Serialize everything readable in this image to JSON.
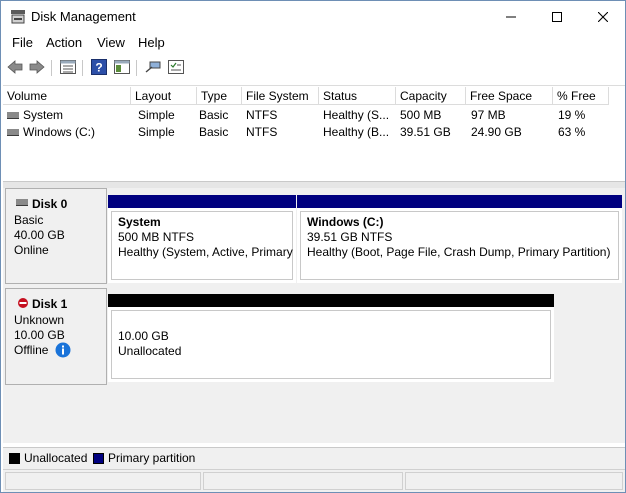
{
  "window": {
    "title": "Disk Management"
  },
  "menu": [
    "File",
    "Action",
    "View",
    "Help"
  ],
  "volume_list": {
    "columns": [
      "Volume",
      "Layout",
      "Type",
      "File System",
      "Status",
      "Capacity",
      "Free Space",
      "% Free"
    ],
    "rows": [
      [
        "System",
        "Simple",
        "Basic",
        "NTFS",
        "Healthy (S...",
        "500 MB",
        "97 MB",
        "19 %"
      ],
      [
        "Windows (C:)",
        "Simple",
        "Basic",
        "NTFS",
        "Healthy (B...",
        "39.51 GB",
        "24.90 GB",
        "63 %"
      ]
    ]
  },
  "disks": [
    {
      "name": "Disk 0",
      "type": "Basic",
      "size": "40.00 GB",
      "state": "Online",
      "partitions": [
        {
          "title": "System",
          "size": "500 MB NTFS",
          "status": "Healthy (System, Active, Primary"
        },
        {
          "title": "Windows  (C:)",
          "size": "39.51 GB NTFS",
          "status": "Healthy (Boot, Page File, Crash Dump, Primary Partition)"
        }
      ]
    },
    {
      "name": "Disk 1",
      "type": "Unknown",
      "size": "10.00 GB",
      "state": "Offline",
      "partitions": [
        {
          "size": "10.00 GB",
          "status": "Unallocated"
        }
      ]
    }
  ],
  "legend": [
    {
      "label": "Unallocated",
      "color": "#000000"
    },
    {
      "label": "Primary partition",
      "color": "#00007f"
    }
  ],
  "colors": {
    "primary": "#00007f",
    "unallocated": "#000000",
    "info": "#1a73d9",
    "offline": "#c50f1f"
  },
  "icons": [
    "disk-management-icon",
    "back-arrow-icon",
    "forward-arrow-icon",
    "properties-icon",
    "help-icon",
    "console-icon",
    "connect-icon",
    "checklist-icon",
    "minimize-icon",
    "maximize-icon",
    "close-icon",
    "volume-icon",
    "disk-icon",
    "disk-offline-icon",
    "info-icon"
  ]
}
